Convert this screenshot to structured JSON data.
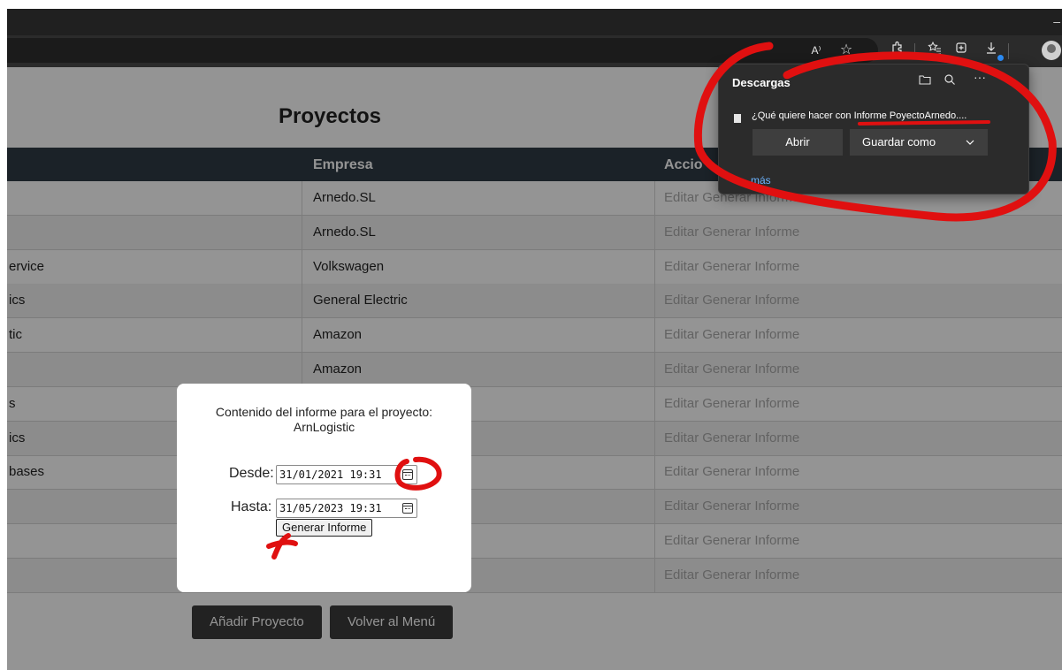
{
  "browser": {
    "window_minimize": "–",
    "toolbar_icons": [
      "read-aloud-icon",
      "favorite-star-icon",
      "extensions-icon",
      "favorites-bar-icon",
      "collections-icon",
      "downloads-icon",
      "profile-icon"
    ],
    "read_aloud_glyph": "A⁾"
  },
  "page": {
    "title": "Proyectos",
    "columns": [
      "",
      "Empresa",
      "Accio"
    ],
    "rows": [
      {
        "name": "",
        "company": "Arnedo.SL",
        "edit": "Editar",
        "report": "Generar Informe"
      },
      {
        "name": "",
        "company": "Arnedo.SL",
        "edit": "Editar",
        "report": "Generar Informe"
      },
      {
        "name": "ervice",
        "company": "Volkswagen",
        "edit": "Editar",
        "report": "Generar Informe"
      },
      {
        "name": "ics",
        "company": "General Electric",
        "edit": "Editar",
        "report": "Generar Informe"
      },
      {
        "name": "tic",
        "company": "Amazon",
        "edit": "Editar",
        "report": "Generar Informe"
      },
      {
        "name": "",
        "company": "Amazon",
        "edit": "Editar",
        "report": "Generar Informe"
      },
      {
        "name": "s",
        "company": "",
        "edit": "Editar",
        "report": "Generar Informe"
      },
      {
        "name": "ics",
        "company": "",
        "edit": "Editar",
        "report": "Generar Informe"
      },
      {
        "name": "bases",
        "company": "",
        "edit": "Editar",
        "report": "Generar Informe"
      },
      {
        "name": "",
        "company": "",
        "edit": "Editar",
        "report": "Generar Informe"
      },
      {
        "name": "",
        "company": "",
        "edit": "Editar",
        "report": "Generar Informe"
      },
      {
        "name": "",
        "company": "",
        "edit": "Editar",
        "report": "Generar Informe"
      }
    ],
    "add_button": "Añadir Proyecto",
    "back_button": "Volver al Menú"
  },
  "modal": {
    "line1": "Contenido del informe para el proyecto:",
    "line2": "ArnLogistic",
    "from_label": "Desde:",
    "from_value": "31/01/2021 19:31",
    "to_label": "Hasta:",
    "to_value": "31/05/2023 19:31",
    "generate_button": "Generar Informe"
  },
  "downloads": {
    "title": "Descargas",
    "question": "¿Qué quiere hacer con Informe PoyectoArnedo....",
    "open_button": "Abrir",
    "save_as_button": "Guardar como",
    "more_link": "más"
  },
  "colors": {
    "table_header": "#2f3b45",
    "action_text": "#aaaaaa",
    "annotation_red": "#e01010",
    "browser_dark": "#202020",
    "panel_bg": "#2b2b2b",
    "link_blue": "#6cb3ff"
  }
}
